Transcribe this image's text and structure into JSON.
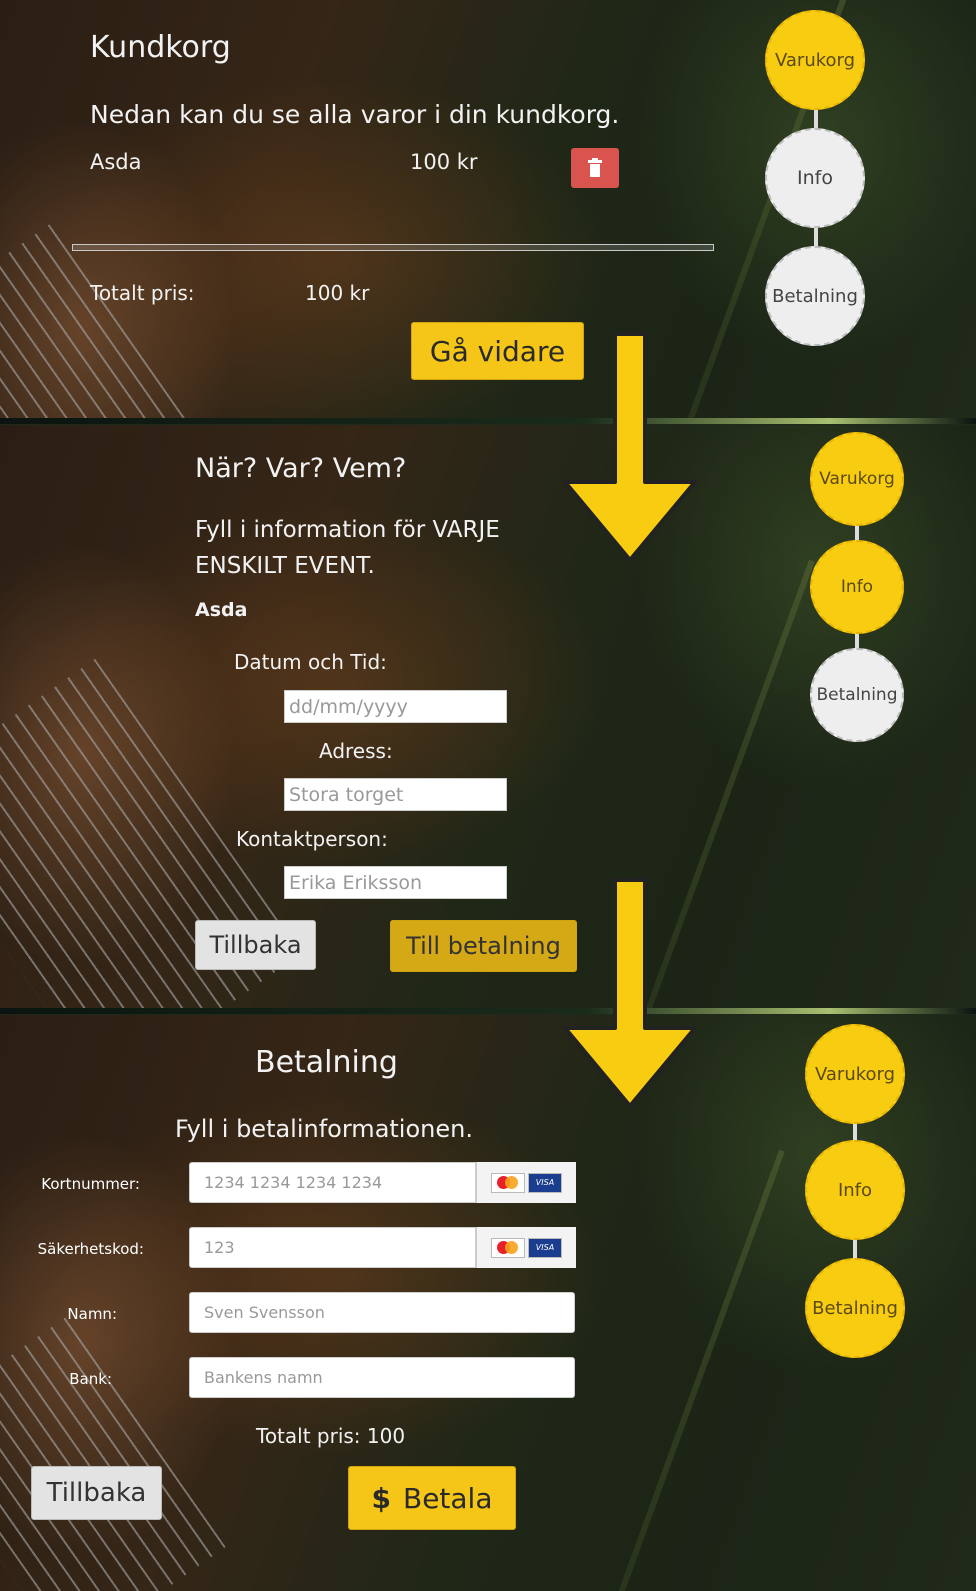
{
  "cart": {
    "title": "Kundkorg",
    "subtitle": "Nedan kan du se alla varor i din kundkorg.",
    "item_name": "Asda",
    "item_price": "100 kr",
    "total_label": "Totalt pris:",
    "total_value": "100 kr",
    "next_button": "Gå vidare"
  },
  "info": {
    "title": "När? Var? Vem?",
    "instruction_line1": "Fyll i information för VARJE",
    "instruction_line2": "ENSKILT EVENT.",
    "event_name": "Asda",
    "date_label": "Datum och Tid:",
    "date_placeholder": "dd/mm/yyyy",
    "address_label": "Adress:",
    "address_placeholder": "Stora torget",
    "contact_label": "Kontaktperson:",
    "contact_placeholder": "Erika Eriksson",
    "back_button": "Tillbaka",
    "pay_button": "Till betalning"
  },
  "payment": {
    "title": "Betalning",
    "instruction": "Fyll i betalinformationen.",
    "card_label": "Kortnummer:",
    "card_placeholder": "1234 1234 1234 1234",
    "cvc_label": "Säkerhetskod:",
    "cvc_placeholder": "123",
    "name_label": "Namn:",
    "name_placeholder": "Sven Svensson",
    "bank_label": "Bank:",
    "bank_placeholder": "Bankens namn",
    "total_text": "Totalt pris: 100",
    "back_button": "Tillbaka",
    "pay_button": "Betala",
    "pay_symbol": "$",
    "visa_text": "VISA"
  },
  "steps": {
    "cart": "Varukorg",
    "info": "Info",
    "payment": "Betalning"
  },
  "colors": {
    "accent": "#f8cc10",
    "danger": "#d9534f",
    "inactive_step": "#eeeeee"
  }
}
